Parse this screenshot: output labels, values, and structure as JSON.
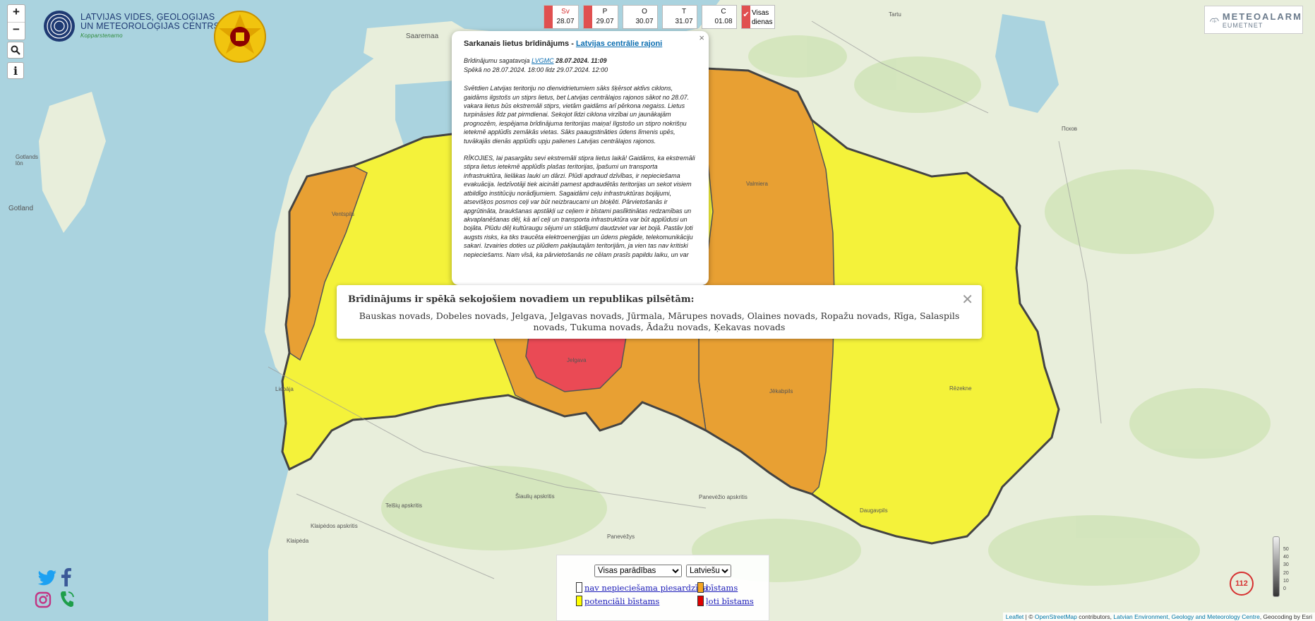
{
  "map_labels": {
    "saaremaa": "Saaremaa",
    "gotland": "Gotland",
    "gotlands_ion": "Gotlands\nlön",
    "ventspils": "Ventspils",
    "jelgava": "Jelgava",
    "valmiera": "Valmiera",
    "jekabpils": "Jēkabpils",
    "rezekne": "Rēzekne",
    "daugavpils": "Daugavpils",
    "liepaja": "Liepāja",
    "klaipeda": "Klaipėda",
    "panevezys": "Panevėžys",
    "pskov": "Псков",
    "tartu": "Tartu",
    "telsiu": "Telšių apskritis",
    "siauliu": "Šiaulių apskritis",
    "panevezio": "Panevėžio apskritis",
    "klaipedos": "Klaipėdos apskritis"
  },
  "controls": {
    "zoom_in": "+",
    "zoom_out": "−",
    "search": "⌕",
    "info": "i"
  },
  "logo": {
    "line1": "LATVIJAS VIDES, ĢEOLOĢIJAS",
    "line2": "UN METEOROLOĢIJAS CENTRS",
    "sub": "Kopparstenarno"
  },
  "days": [
    {
      "abbr": "Sv",
      "date": "28.07",
      "color": "#e05050",
      "red": true
    },
    {
      "abbr": "P",
      "date": "29.07",
      "color": "#e05050",
      "red": false
    },
    {
      "abbr": "O",
      "date": "30.07",
      "color": "#ffffff",
      "red": false
    },
    {
      "abbr": "T",
      "date": "31.07",
      "color": "#ffffff",
      "red": false
    },
    {
      "abbr": "C",
      "date": "01.08",
      "color": "#ffffff",
      "red": false
    }
  ],
  "visas": {
    "check": "✔",
    "line1": "Visas",
    "line2": "dienas"
  },
  "meteoalarm": {
    "title": "METEOALARM",
    "sub": "EUMETNET"
  },
  "popup": {
    "title_prefix": "Sarkanais lietus brīdinājums - ",
    "title_link": "Latvijas centrālie rajoni",
    "prep_prefix": "Brīdinājumu sagatavoja ",
    "prep_link": "LVGMC",
    "prep_date": " 28.07.2024. 11:09",
    "valid": "Spēkā no 28.07.2024. 18:00 līdz 29.07.2024. 12:00",
    "para1": "Svētdien Latvijas teritoriju no dienvidrietumiem sāks šķērsot aktīvs ciklons, gaidāms ilgstošs un stiprs lietus, bet Latvijas centrālajos rajonos sākot no 28.07. vakara lietus būs ekstremāli stiprs, vietām gaidāms arī pērkona negaiss. Lietus turpināsies līdz pat pirmdienai. Sekojot līdzi ciklona virzībai un jaunākajām prognozēm, iespējama brīdinājuma teritorijas maiņa! Ilgstošo un stipro nokrišņu ietekmē applūdīs zemākās vietas. Sāks paaugstināties ūdens līmenis upēs, tuvākajās dienās applūdīs upju palienes Latvijas centrālajos rajonos.",
    "para2": "RĪKOJIES, lai pasargātu sevi ekstremāli stipra lietus laikā! Gaidāms, ka ekstremāli stipra lietus ietekmē applūdīs plašas teritorijas, īpašumi un transporta infrastruktūra, lielākas lauki un dārzi. Plūdi apdraud dzīvības, ir nepieciešama evakuācija. Iedzīvotāji tiek aicināti pamest apdraudētās teritorijas un sekot visiem atbildīgo institūciju norādījumiem. Sagaidāmi ceļu infrastruktūras bojājumi, atsevišķos posmos ceļi var būt neizbraucami un bloķēti. Pārvietošanās ir apgrūtināta, braukšanas apstākļi uz ceļiem ir bīstami paslīktinātas redzamības un akvaplanēšanas dēļ, kā arī ceļi un transporta infrastruktūra var būt applūdusi un bojāta. Plūdu dēļ kultūraugu sējumi un stādījumi daudzviet var iet bojā. Pastāv ļoti augsts risks, ka tiks traucēta elektroenerģijas un ūdens piegāde, telekomunikāciju sakari. Izvairies doties uz plūdiem pakļautajām teritorijām, ja vien tas nav kritiski nepieciešams. Nam vīsā, ka pārvietošanās ne cēlam prasīs papildu laiku, un var",
    "close": "×"
  },
  "notice": {
    "title": "Brīdinājums ir spēkā sekojošiem novadiem un republikas pilsētām:",
    "body": "Bauskas novads, Dobeles novads, Jelgava, Jelgavas novads, Jūrmala, Mārupes novads, Olaines novads, Ropažu novads, Rīga, Salaspils novads, Tukuma novads, Ādažu novads, Ķekavas novads",
    "close": "✕"
  },
  "legend": {
    "select1": "Visas parādības",
    "select2": "Latviešu",
    "items": [
      {
        "label": "nav nepieciešama piesardzība",
        "color": "#ffffff"
      },
      {
        "label": "bīstams",
        "color": "#f5a623"
      },
      {
        "label": "potenciāli bīstams",
        "color": "#ffff00"
      },
      {
        "label": "ļoti bīstams",
        "color": "#e00000"
      }
    ]
  },
  "emergency": {
    "number": "112"
  },
  "scale_ticks": [
    "50",
    "40",
    "30",
    "20",
    "10",
    "0"
  ],
  "attribution": {
    "leaflet": "Leaflet",
    "sep1": " | © ",
    "osm": "OpenStreetMap",
    "mid": " contributors, ",
    "lvgmc": "Latvian Environment, Geology and Meteorology Centre",
    "end": ", Geocoding by Esri"
  },
  "colors": {
    "sea": "#aad3df",
    "land": "#e8eedb",
    "yellow": "#f4f23a",
    "orange": "#e8a033",
    "red": "#ea4a55",
    "border": "#444444"
  }
}
